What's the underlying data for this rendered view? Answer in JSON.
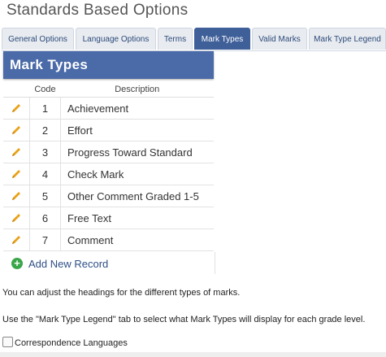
{
  "page_title": "Standards Based Options",
  "tabs": [
    {
      "label": "General Options",
      "active": false
    },
    {
      "label": "Language Options",
      "active": false
    },
    {
      "label": "Terms",
      "active": false
    },
    {
      "label": "Mark Types",
      "active": true
    },
    {
      "label": "Valid Marks",
      "active": false
    },
    {
      "label": "Mark Type Legend",
      "active": false
    }
  ],
  "panel": {
    "title": "Mark Types",
    "columns": {
      "code": "Code",
      "description": "Description"
    },
    "rows": [
      {
        "code": "1",
        "description": "Achievement"
      },
      {
        "code": "2",
        "description": "Effort"
      },
      {
        "code": "3",
        "description": "Progress Toward Standard"
      },
      {
        "code": "4",
        "description": "Check Mark"
      },
      {
        "code": "5",
        "description": "Other Comment Graded 1-5"
      },
      {
        "code": "6",
        "description": "Free Text"
      },
      {
        "code": "7",
        "description": "Comment"
      }
    ],
    "add_label": "Add New Record",
    "add_icon": "plus-circle-icon",
    "edit_icon": "pencil-icon"
  },
  "notes": {
    "line1": "You can adjust the headings for the different types of marks.",
    "line2": "Use the \"Mark Type Legend\" tab to select what Mark Types will display for each grade level."
  },
  "checkbox": {
    "label": "Correspondence Languages",
    "checked": false
  },
  "colors": {
    "header": "#4a6aa8",
    "active_tab": "#3f5f99",
    "pencil": "#e8a21a",
    "add": "#3aa64a"
  }
}
